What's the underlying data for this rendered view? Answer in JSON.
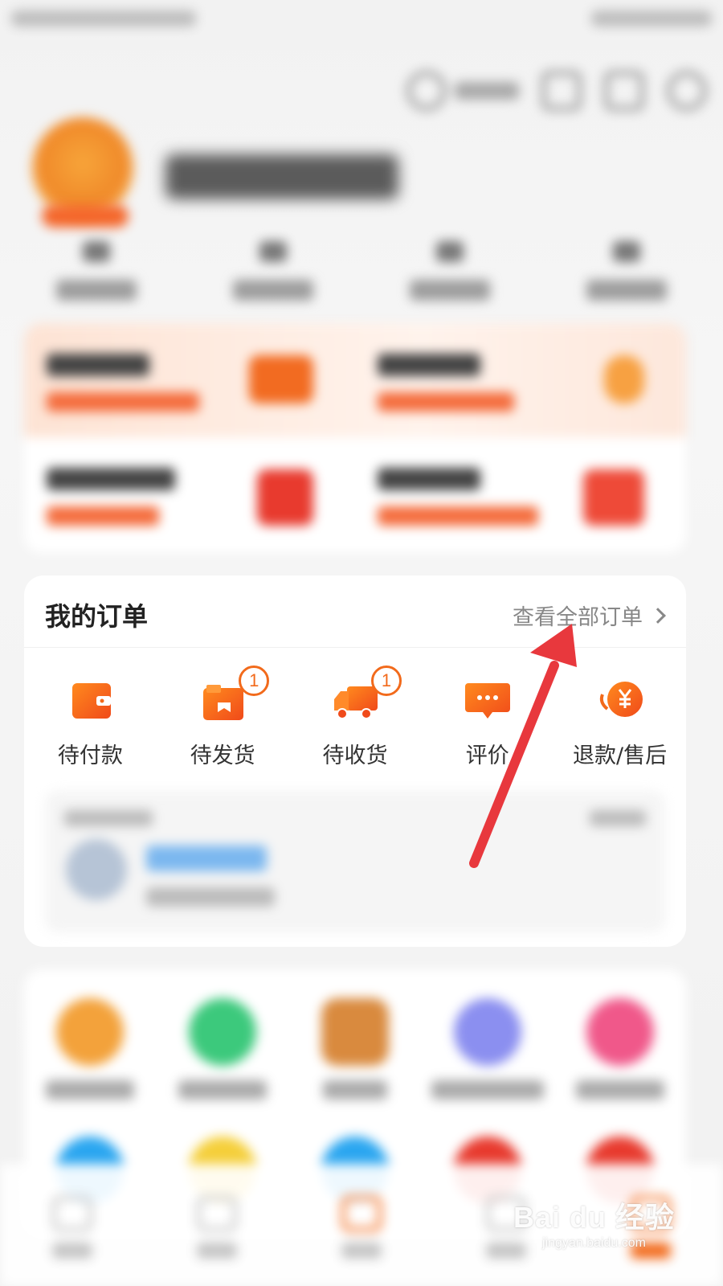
{
  "orders": {
    "title": "我的订单",
    "view_all": "查看全部订单",
    "items": [
      {
        "label": "待付款"
      },
      {
        "label": "待发货",
        "badge": "1"
      },
      {
        "label": "待收货",
        "badge": "1"
      },
      {
        "label": "评价"
      },
      {
        "label": "退款/售后"
      }
    ]
  },
  "watermark": {
    "main": "Bai du 经验",
    "sub": "jingyan.baidu.com"
  },
  "colors": {
    "accent": "#f26a1b",
    "arrow": "#e8383d"
  },
  "icons": [
    "wallet-icon",
    "box-icon",
    "truck-icon",
    "chat-icon",
    "refund-yen-icon"
  ]
}
